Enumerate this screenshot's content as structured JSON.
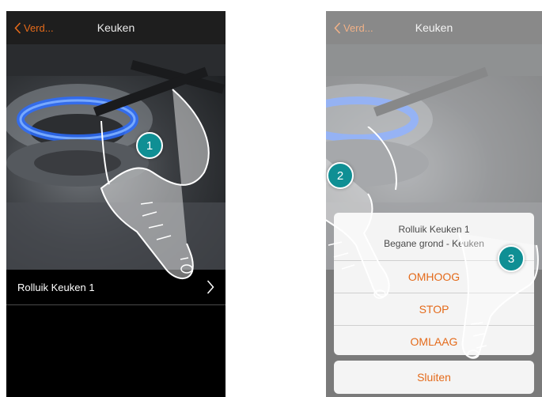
{
  "left_screen": {
    "back_label": "Verd...",
    "title": "Keuken",
    "row_label": "Rolluik Keuken 1",
    "step": "1"
  },
  "right_screen": {
    "back_label": "Verd...",
    "title": "Keuken",
    "sheet_title": "Rolluik Keuken 1",
    "sheet_subtitle": "Begane grond - Keuken",
    "options": [
      "OMHOOG",
      "STOP",
      "OMLAAG"
    ],
    "close_label": "Sluiten",
    "steps": [
      "2",
      "3"
    ]
  },
  "colors": {
    "accent": "#e46a1a",
    "badge": "#0f8f94",
    "titlebar": "#1e1e1e",
    "sheet": "#f4f4f4"
  },
  "icons": [
    "chevron-left-icon",
    "chevron-right-icon",
    "pointing-hand-icon"
  ]
}
